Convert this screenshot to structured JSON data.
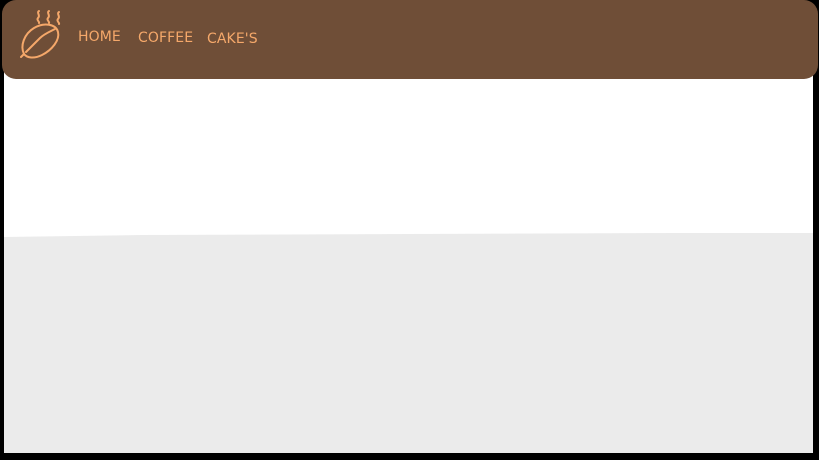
{
  "nav": {
    "background": "#6f4e37",
    "link_color": "#f5a86a",
    "logo_icon": "coffee-bean-steam-icon",
    "links": [
      {
        "label": "HOME"
      },
      {
        "label": "COFFEE"
      },
      {
        "label": "CAKE'S"
      }
    ]
  },
  "hero": {
    "background": "#ffffff"
  },
  "section": {
    "background": "#ebebeb"
  }
}
